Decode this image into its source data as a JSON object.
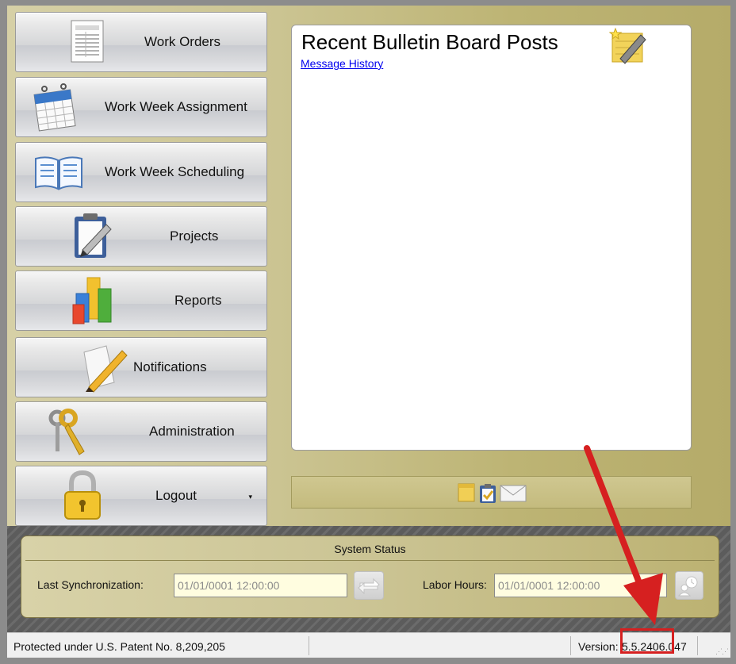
{
  "nav": {
    "work_orders": "Work Orders",
    "work_week_assignment": "Work Week Assignment",
    "work_week_scheduling": "Work Week Scheduling",
    "projects": "Projects",
    "reports": "Reports",
    "notifications": "Notifications",
    "administration": "Administration",
    "logout": "Logout",
    "logout_dropdown": "▾"
  },
  "bulletin": {
    "title": "Recent Bulletin Board Posts",
    "message_history_link": "Message History",
    "toolbar_icons": [
      "sticky-note-icon",
      "clipboard-check-icon",
      "envelope-icon"
    ]
  },
  "system_status": {
    "title": "System Status",
    "last_sync_label": "Last Synchronization:",
    "last_sync_value": "01/01/0001 12:00:00",
    "labor_hours_label": "Labor Hours:",
    "labor_hours_value": "01/01/0001 12:00:00"
  },
  "footer": {
    "patent": "Protected under U.S. Patent No. 8,209,205",
    "version_label": "Version:",
    "version_value": "5.5.2406.047"
  },
  "annotation": {
    "color": "#d62020"
  },
  "icons": {
    "work_orders": "document-list-icon",
    "work_week_assignment": "calendar-icon",
    "work_week_scheduling": "open-book-icon",
    "projects": "clipboard-pencil-icon",
    "reports": "bar-chart-icon",
    "notifications": "note-pencil-icon",
    "administration": "keys-icon",
    "logout": "padlock-icon",
    "sync": "sync-arrows-icon",
    "labor": "clock-person-icon"
  }
}
